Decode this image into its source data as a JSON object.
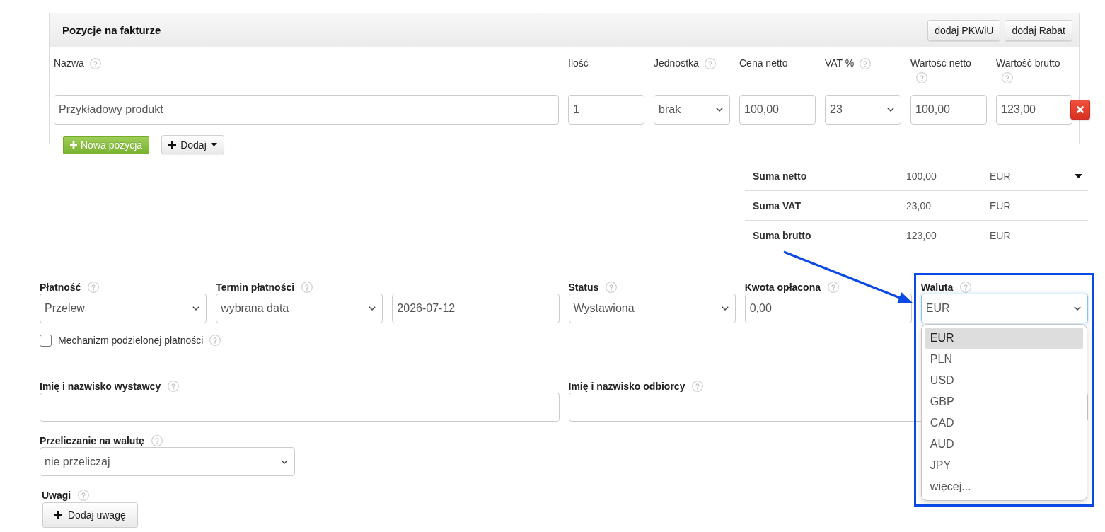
{
  "items_panel": {
    "title": "Pozycje na fakturze",
    "header_buttons": [
      "dodaj PKWiU",
      "dodaj Rabat"
    ],
    "columns": [
      {
        "label": "Nazwa",
        "help": true
      },
      {
        "label": "Ilość",
        "help": false
      },
      {
        "label": "Jednostka",
        "help": true
      },
      {
        "label": "Cena netto",
        "help": false
      },
      {
        "label": "VAT %",
        "help": true
      },
      {
        "label": "Wartość netto",
        "help": true
      },
      {
        "label": "Wartość brutto",
        "help": true
      }
    ],
    "rows": [
      {
        "cells": [
          {
            "kind": "input",
            "value": "Przykładowy produkt"
          },
          {
            "kind": "input",
            "value": "1"
          },
          {
            "kind": "select",
            "value": "brak"
          },
          {
            "kind": "input",
            "value": "100,00"
          },
          {
            "kind": "select",
            "value": "23"
          },
          {
            "kind": "input",
            "value": "100,00"
          },
          {
            "kind": "input",
            "value": "123,00"
          }
        ]
      }
    ]
  },
  "item_buttons": [
    {
      "kind": "primary",
      "label": "Nowa pozycja"
    },
    {
      "kind": "menu",
      "label": "Dodaj"
    }
  ],
  "totals": [
    {
      "label": "Suma netto",
      "value": "100,00",
      "currency": "EUR",
      "expandable": true
    },
    {
      "label": "Suma VAT",
      "value": "23,00",
      "currency": "EUR",
      "expandable": false
    },
    {
      "label": "Suma brutto",
      "value": "123,00",
      "currency": "EUR",
      "expandable": false
    }
  ],
  "payment_fields": [
    {
      "label": "Płatność",
      "help": true,
      "kind": "select",
      "value": "Przelew",
      "open": false
    },
    {
      "label": "Termin płatności",
      "help": true,
      "kind": "select",
      "value": "wybrana data",
      "open": false
    },
    {
      "help": false,
      "kind": "input",
      "value": "2026-07-12",
      "open": false
    },
    {
      "label": "Status",
      "help": true,
      "kind": "select",
      "value": "Wystawiona",
      "open": false
    },
    {
      "label": "Kwota opłacona",
      "help": true,
      "kind": "input",
      "value": "0,00",
      "open": false
    },
    {
      "label": "Waluta",
      "help": true,
      "kind": "select",
      "value": "EUR",
      "open": true,
      "options": [
        {
          "label": "EUR",
          "selected": true
        },
        {
          "label": "PLN",
          "selected": false
        },
        {
          "label": "USD",
          "selected": false
        },
        {
          "label": "GBP",
          "selected": false
        },
        {
          "label": "CAD",
          "selected": false
        },
        {
          "label": "AUD",
          "selected": false
        },
        {
          "label": "JPY",
          "selected": false
        },
        {
          "label": "więcej...",
          "selected": false
        }
      ]
    }
  ],
  "split_payment": {
    "label": "Mechanizm podzielonej płatności",
    "checked": false,
    "help": true
  },
  "signatures": [
    {
      "label": "Imię i nazwisko wystawcy",
      "help": true
    },
    {
      "label": "Imię i nazwisko odbiorcy",
      "help": true
    }
  ],
  "conversion": {
    "label": "Przeliczanie na walutę",
    "help": true,
    "kind": "select",
    "value": "nie przeliczaj"
  },
  "notes": {
    "label": "Uwagi",
    "help": true,
    "button": "Dodaj uwagę"
  }
}
